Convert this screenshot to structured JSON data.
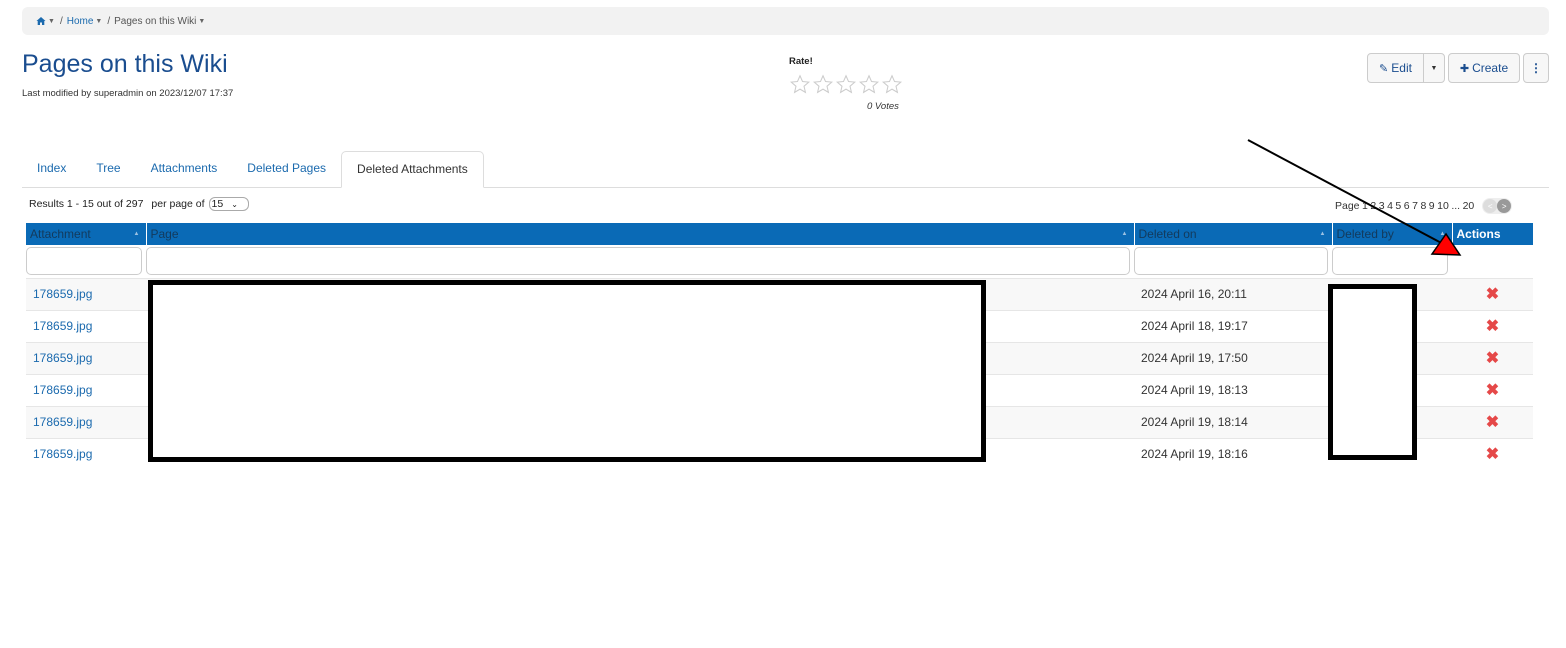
{
  "breadcrumb": {
    "home_icon": "home-icon",
    "items": [
      {
        "label": "Home"
      },
      {
        "label": "Pages on this Wiki"
      }
    ]
  },
  "header": {
    "title": "Pages on this Wiki",
    "last_modified": "Last modified by superadmin on 2023/12/07 17:37"
  },
  "rating": {
    "label": "Rate!",
    "stars_total": 5,
    "stars_filled": 0,
    "votes": "0 Votes"
  },
  "toolbar": {
    "edit_label": "Edit",
    "edit_icon": "pencil-icon",
    "create_label": "Create",
    "create_icon": "plus-icon",
    "more_icon": "vertical-ellipsis-icon"
  },
  "tabs": [
    {
      "label": "Index",
      "active": false
    },
    {
      "label": "Tree",
      "active": false
    },
    {
      "label": "Attachments",
      "active": false
    },
    {
      "label": "Deleted Pages",
      "active": false
    },
    {
      "label": "Deleted Attachments",
      "active": true
    }
  ],
  "results": {
    "summary": "Results 1 - 15 out of 297",
    "per_page_label": "per page of",
    "per_page_value": "15"
  },
  "pagination": {
    "label": "Page",
    "pages": [
      "1",
      "2",
      "3",
      "4",
      "5",
      "6",
      "7",
      "8",
      "9",
      "10",
      "...",
      "20"
    ],
    "current": "1",
    "prev_label": "<",
    "next_label": ">"
  },
  "table": {
    "columns": [
      {
        "label": "Attachment",
        "sortable": true
      },
      {
        "label": "Page",
        "sortable": true
      },
      {
        "label": "Deleted on",
        "sortable": true
      },
      {
        "label": "Deleted by",
        "sortable": true
      },
      {
        "label": "Actions",
        "sortable": false
      }
    ],
    "rows": [
      {
        "attachment": "178659.jpg",
        "page": "",
        "deleted_on": "2024 April 16, 20:11",
        "deleted_by": "",
        "action_icon": "delete-x-icon"
      },
      {
        "attachment": "178659.jpg",
        "page": "",
        "deleted_on": "2024 April 18, 19:17",
        "deleted_by": "",
        "action_icon": "delete-x-icon"
      },
      {
        "attachment": "178659.jpg",
        "page": "",
        "deleted_on": "2024 April 19, 17:50",
        "deleted_by": "",
        "action_icon": "delete-x-icon"
      },
      {
        "attachment": "178659.jpg",
        "page": "",
        "deleted_on": "2024 April 19, 18:13",
        "deleted_by": "",
        "action_icon": "delete-x-icon"
      },
      {
        "attachment": "178659.jpg",
        "page": "",
        "deleted_on": "2024 April 19, 18:14",
        "deleted_by": "",
        "action_icon": "delete-x-icon"
      },
      {
        "attachment": "178659.jpg",
        "page": "",
        "deleted_on": "2024 April 19, 18:16",
        "deleted_by": "",
        "action_icon": "delete-x-icon"
      }
    ]
  },
  "colors": {
    "header_bg": "#0a6ab6",
    "link": "#1b6aae",
    "title": "#1a4d8f",
    "delete_icon": "#e54848",
    "annotation_arrow": "#ff0000"
  },
  "glyphs": {
    "caret": "▼",
    "sep": "/",
    "sort": "▲",
    "delete": "✖",
    "ellipsis": "⋮",
    "plus": "✚",
    "pencil": "✎",
    "chevron": "⌄"
  }
}
